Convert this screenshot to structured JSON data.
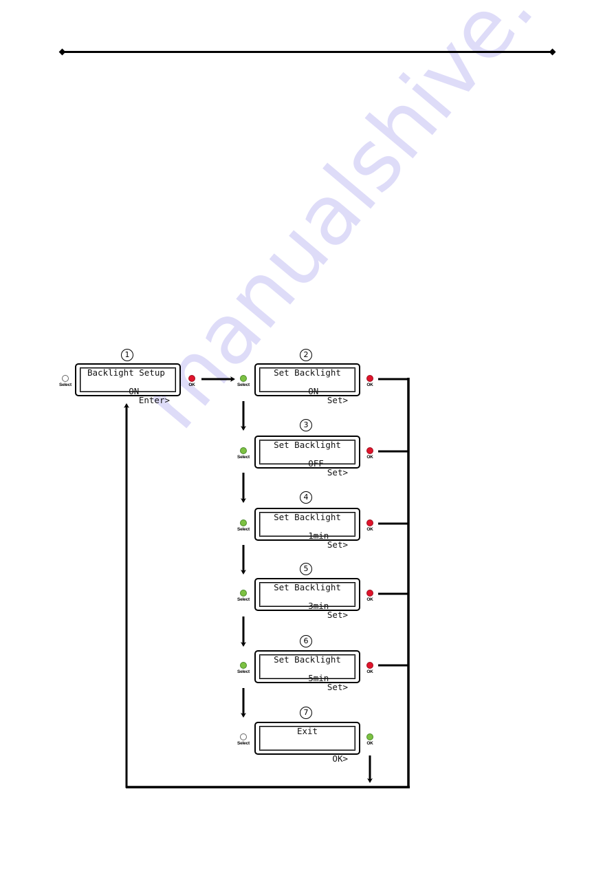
{
  "watermark": "manualshive.com",
  "colors": {
    "led_green": "#7cc142",
    "led_red": "#e0142b",
    "watermark": "#d9d6f7"
  },
  "steps": [
    {
      "number": "1",
      "line1_left": "Backlight Setup",
      "line1_right": "",
      "line2_left": "ON",
      "line2_right": "Enter>",
      "select_led": "off",
      "ok_led": "red",
      "select_label": "Select",
      "ok_label": "OK"
    },
    {
      "number": "2",
      "line1_left": "Set Backlight",
      "line1_right": "",
      "line2_left": "ON",
      "line2_right": "Set>",
      "select_led": "green",
      "ok_led": "red",
      "select_label": "Select",
      "ok_label": "OK"
    },
    {
      "number": "3",
      "line1_left": "Set Backlight",
      "line1_right": "",
      "line2_left": "OFF",
      "line2_right": "Set>",
      "select_led": "green",
      "ok_led": "red",
      "select_label": "Select",
      "ok_label": "OK"
    },
    {
      "number": "4",
      "line1_left": "Set Backlight",
      "line1_right": "",
      "line2_left": "1min",
      "line2_right": "Set>",
      "select_led": "green",
      "ok_led": "red",
      "select_label": "Select",
      "ok_label": "OK"
    },
    {
      "number": "5",
      "line1_left": "Set Backlight",
      "line1_right": "",
      "line2_left": "3min",
      "line2_right": "Set>",
      "select_led": "green",
      "ok_led": "red",
      "select_label": "Select",
      "ok_label": "OK"
    },
    {
      "number": "6",
      "line1_left": "Set Backlight",
      "line1_right": "",
      "line2_left": "5min",
      "line2_right": "Set>",
      "select_led": "green",
      "ok_led": "red",
      "select_label": "Select",
      "ok_label": "OK"
    },
    {
      "number": "7",
      "line1_left": "Exit",
      "line1_right": "",
      "line2_left": "",
      "line2_right": "OK>",
      "select_led": "off",
      "ok_led": "green",
      "select_label": "Select",
      "ok_label": "OK"
    }
  ]
}
